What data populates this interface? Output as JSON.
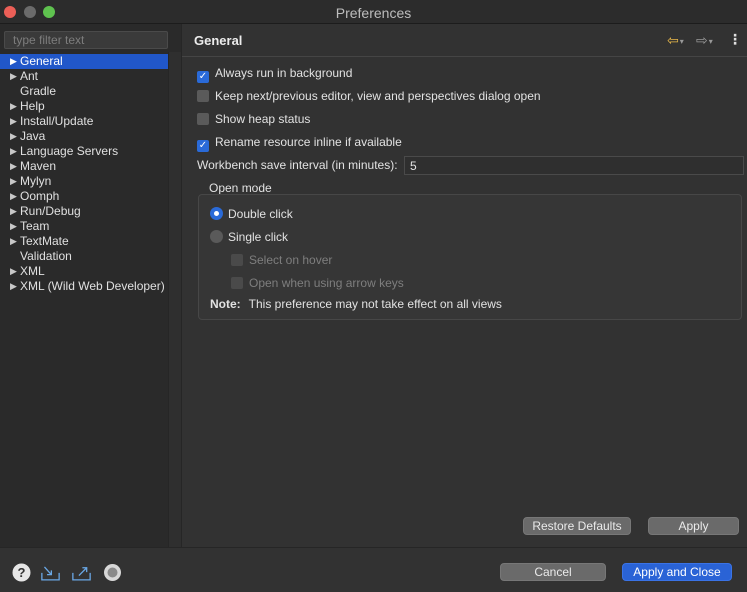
{
  "window": {
    "title": "Preferences"
  },
  "sidebar": {
    "filter_placeholder": "type filter text",
    "items": [
      {
        "label": "General",
        "expandable": true,
        "selected": true
      },
      {
        "label": "Ant",
        "expandable": true
      },
      {
        "label": "Gradle",
        "expandable": false
      },
      {
        "label": "Help",
        "expandable": true
      },
      {
        "label": "Install/Update",
        "expandable": true
      },
      {
        "label": "Java",
        "expandable": true
      },
      {
        "label": "Language Servers",
        "expandable": true
      },
      {
        "label": "Maven",
        "expandable": true
      },
      {
        "label": "Mylyn",
        "expandable": true
      },
      {
        "label": "Oomph",
        "expandable": true
      },
      {
        "label": "Run/Debug",
        "expandable": true
      },
      {
        "label": "Team",
        "expandable": true
      },
      {
        "label": "TextMate",
        "expandable": true
      },
      {
        "label": "Validation",
        "expandable": false
      },
      {
        "label": "XML",
        "expandable": true
      },
      {
        "label": "XML (Wild Web Developer)",
        "expandable": true
      }
    ]
  },
  "main": {
    "title": "General",
    "options": {
      "always_run_background": {
        "label": "Always run in background",
        "checked": true
      },
      "keep_next_prev": {
        "label": "Keep next/previous editor, view and perspectives dialog open",
        "checked": false
      },
      "show_heap": {
        "label": "Show heap status",
        "checked": false
      },
      "rename_inline": {
        "label": "Rename resource inline if available",
        "checked": true
      }
    },
    "save_interval": {
      "label": "Workbench save interval (in minutes):",
      "value": "5"
    },
    "open_mode": {
      "label": "Open mode",
      "double_click": "Double click",
      "single_click": "Single click",
      "selected": "double_click",
      "select_on_hover": "Select on hover",
      "open_arrow_keys": "Open when using arrow keys",
      "note_label": "Note:",
      "note_text": "This preference may not take effect on all views"
    },
    "restore_defaults": "Restore Defaults",
    "apply": "Apply"
  },
  "footer": {
    "cancel": "Cancel",
    "apply_close": "Apply and Close"
  },
  "colors": {
    "accent": "#2157c9",
    "checkbox_checked": "#2a6ad8",
    "nav_back": "#e8b84a"
  },
  "icons": {
    "help": "help-icon",
    "import": "import-icon",
    "export": "export-icon",
    "oomph": "oomph-icon",
    "back": "back-arrow-icon",
    "forward": "forward-arrow-icon",
    "menu": "view-menu-icon"
  }
}
